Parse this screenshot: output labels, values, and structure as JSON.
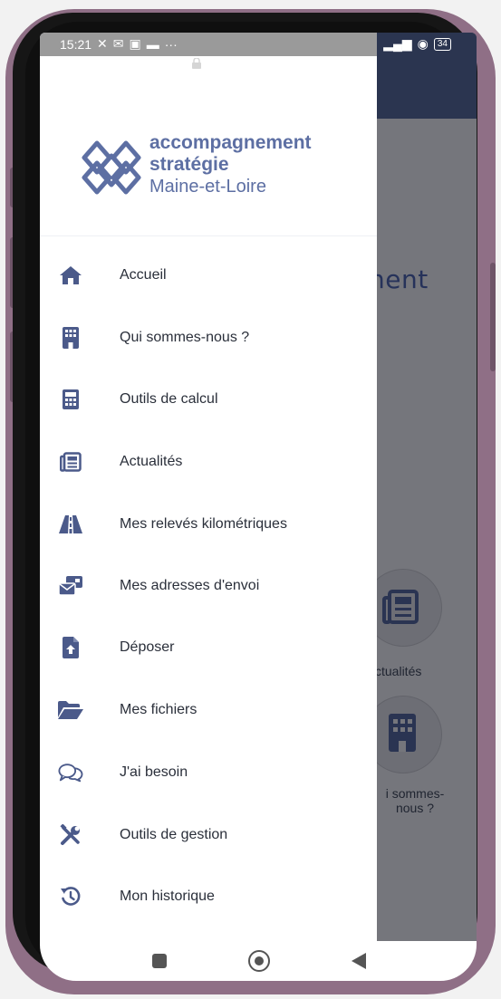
{
  "status_bar": {
    "time": "15:21",
    "notification_icons": [
      "mute-icon",
      "mail-icon",
      "photo-icon",
      "tray-icon"
    ],
    "more": "···",
    "battery": "34"
  },
  "logo": {
    "line1": "accompagnement",
    "line2": "stratégie",
    "line3": "Maine-et-Loire"
  },
  "menu": {
    "items": [
      {
        "label": "Accueil",
        "icon": "home-icon"
      },
      {
        "label": "Qui sommes-nous ?",
        "icon": "building-icon"
      },
      {
        "label": "Outils de calcul",
        "icon": "calculator-icon"
      },
      {
        "label": "Actualités",
        "icon": "newspaper-icon"
      },
      {
        "label": "Mes relevés kilométriques",
        "icon": "road-icon"
      },
      {
        "label": "Mes adresses d'envoi",
        "icon": "mail-address-icon"
      },
      {
        "label": "Déposer",
        "icon": "file-upload-icon"
      },
      {
        "label": "Mes fichiers",
        "icon": "folder-open-icon"
      },
      {
        "label": "J'ai besoin",
        "icon": "chat-bubbles-icon"
      },
      {
        "label": "Outils de gestion",
        "icon": "tools-icon"
      },
      {
        "label": "Mon historique",
        "icon": "history-icon"
      }
    ]
  },
  "background": {
    "heading_fragment": "nent",
    "tile1_label": "ctualités",
    "tile2_label_line1": "i sommes-",
    "tile2_label_line2": "nous ?"
  },
  "colors": {
    "brand": "#5d6fa3",
    "icon": "#4b5a8a",
    "topbar": "#2b3550"
  }
}
